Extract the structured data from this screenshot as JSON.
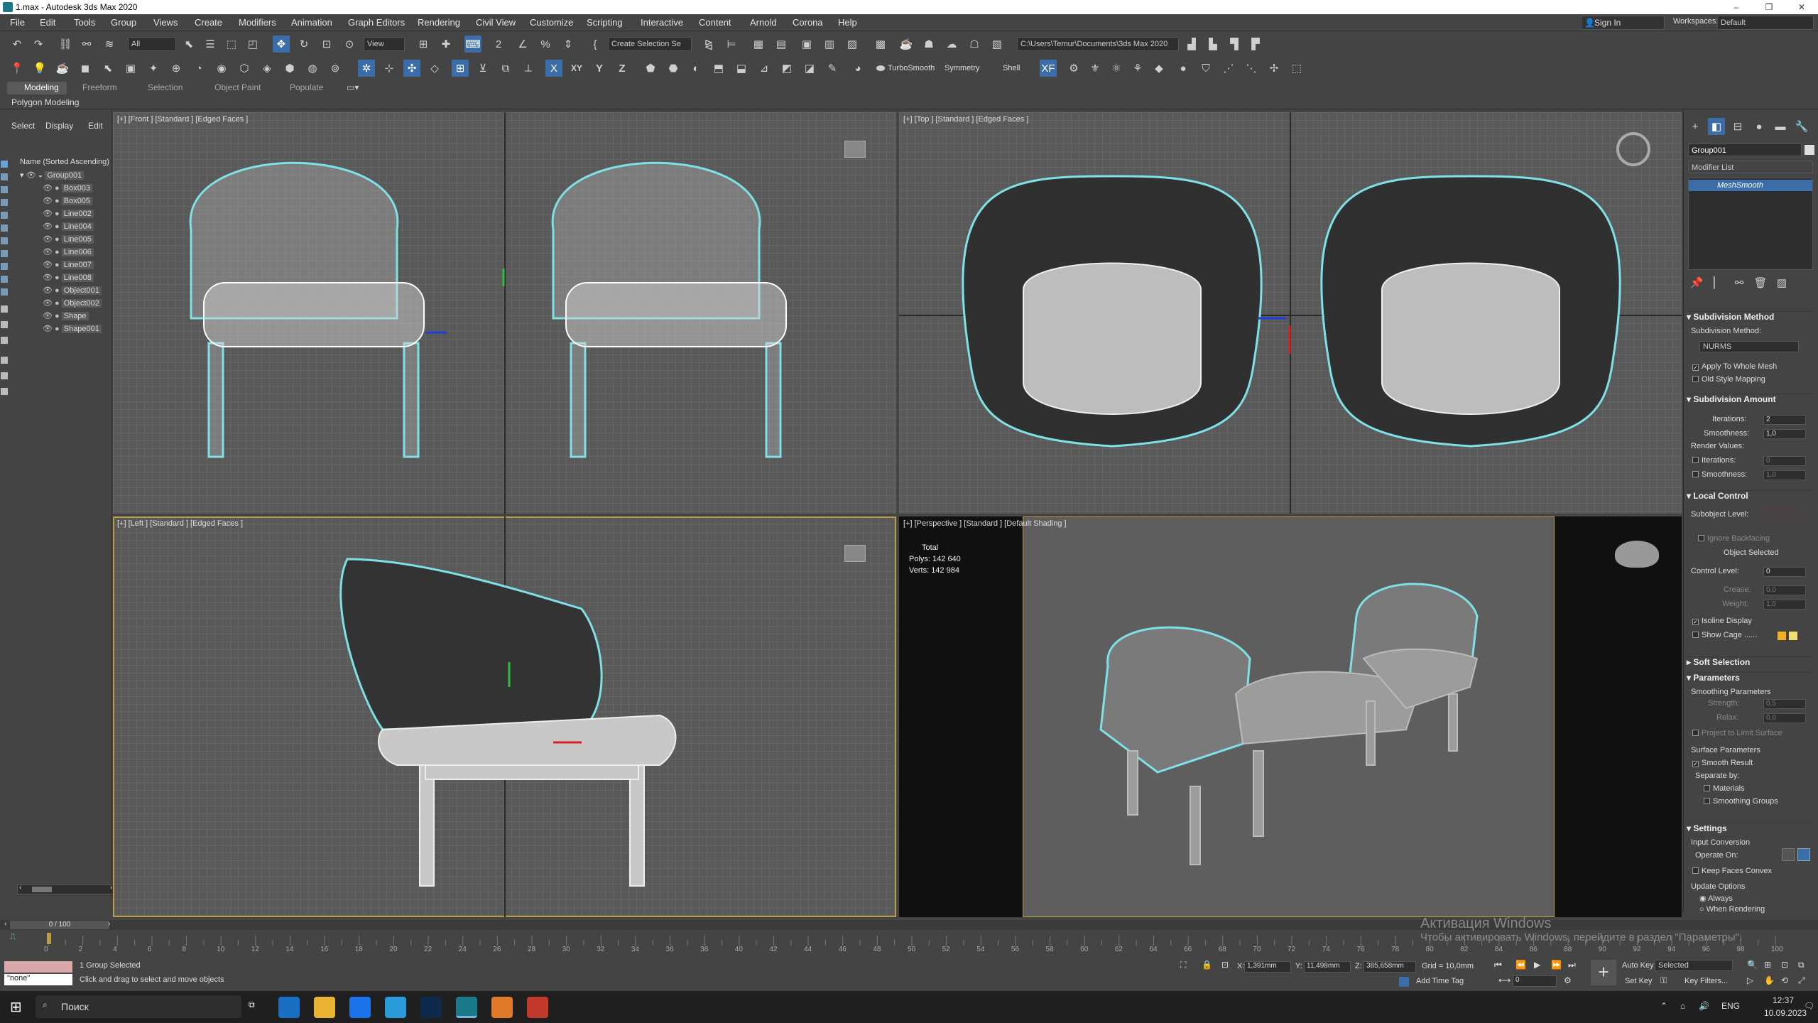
{
  "window": {
    "title": "1.max - Autodesk 3ds Max 2020",
    "minimize": "–",
    "maximize": "❐",
    "close": "✕"
  },
  "menu": [
    "File",
    "Edit",
    "Tools",
    "Group",
    "Views",
    "Create",
    "Modifiers",
    "Animation",
    "Graph Editors",
    "Rendering",
    "Civil View",
    "Customize",
    "Scripting",
    "Interactive",
    "Content",
    "Arnold",
    "Corona",
    "Help"
  ],
  "account": {
    "sign_in": "Sign In",
    "workspaces_label": "Workspaces:",
    "workspace": "Default"
  },
  "toolbar": {
    "filter": "All",
    "view": "View",
    "selection_set": "Create Selection Se",
    "path": "C:\\Users\\Temur\\Documents\\3ds Max 2020"
  },
  "toolbar2": {
    "turbosmooth": "TurboSmooth",
    "symmetry": "Symmetry",
    "shell": "Shell",
    "x": "X",
    "y": "Y",
    "z": "Z",
    "xy": "XY"
  },
  "ribbon": {
    "tabs": [
      "Modeling",
      "Freeform",
      "Selection",
      "Object Paint",
      "Populate"
    ],
    "panel": "Polygon Modeling"
  },
  "scene_explorer": {
    "tabs": [
      "Select",
      "Display",
      "Edit"
    ],
    "sort": "Name (Sorted Ascending)",
    "items": [
      "Group001",
      "Box003",
      "Box005",
      "Line002",
      "Line004",
      "Line005",
      "Line006",
      "Line007",
      "Line008",
      "Object001",
      "Object002",
      "Shape",
      "Shape001"
    ]
  },
  "viewports": {
    "front": "[+] [Front ] [Standard ] [Edged Faces ]",
    "top": "[+] [Top ] [Standard ] [Edged Faces ]",
    "left": "[+] [Left ] [Standard ] [Edged Faces ]",
    "persp": "[+] [Perspective ] [Standard ] [Default Shading ]"
  },
  "stats": {
    "total": "Total",
    "polys_label": "Polys:",
    "polys": "142 640",
    "verts_label": "Verts:",
    "verts": "142 984"
  },
  "command_panel": {
    "object_name": "Group001",
    "modifier_list": "Modifier List",
    "modifier": "MeshSmooth",
    "subdivision_method": {
      "title": "Subdivision Method",
      "label": "Subdivision Method:",
      "value": "NURMS",
      "apply_whole": "Apply To Whole Mesh",
      "old_style": "Old Style Mapping"
    },
    "subdivision_amount": {
      "title": "Subdivision Amount",
      "iterations_label": "Iterations:",
      "iterations": "2",
      "smoothness_label": "Smoothness:",
      "smoothness": "1,0",
      "render_values": "Render Values:",
      "r_iterations": "0",
      "r_smoothness": "1,0"
    },
    "local_control": {
      "title": "Local Control",
      "subobject_level": "Subobject Level:",
      "ignore_backfacing": "Ignore Backfacing",
      "object_selected": "Object Selected",
      "control_level_label": "Control Level:",
      "control_level": "0",
      "crease_label": "Crease:",
      "crease": "0,0",
      "weight_label": "Weight:",
      "weight": "1,0",
      "isoline": "Isoline Display",
      "show_cage": "Show Cage ......"
    },
    "soft_selection": {
      "title": "Soft Selection"
    },
    "parameters": {
      "title": "Parameters",
      "smoothing": "Smoothing Parameters",
      "strength_label": "Strength:",
      "strength": "0,5",
      "relax_label": "Relax:",
      "relax": "0,0",
      "project": "Project to Limit Surface",
      "surface": "Surface Parameters",
      "smooth_result": "Smooth Result",
      "separate_by": "Separate by:",
      "materials": "Materials",
      "smoothing_groups": "Smoothing Groups"
    },
    "settings": {
      "title": "Settings",
      "input_conversion": "Input Conversion",
      "operate_on": "Operate On:",
      "keep_convex": "Keep Faces Convex",
      "update_options": "Update Options",
      "always": "Always",
      "when_rendering": "When Rendering"
    }
  },
  "timeline": {
    "frame": "0 / 100",
    "ticks": [
      "0",
      "2",
      "4",
      "6",
      "8",
      "10",
      "12",
      "14",
      "16",
      "18",
      "20",
      "22",
      "24",
      "26",
      "28",
      "30",
      "32",
      "34",
      "36",
      "38",
      "40",
      "42",
      "44",
      "46",
      "48",
      "50",
      "52",
      "54",
      "56",
      "58",
      "60",
      "62",
      "64",
      "66",
      "68",
      "70",
      "72",
      "74",
      "76",
      "78",
      "80",
      "82",
      "84",
      "86",
      "88",
      "90",
      "92",
      "94",
      "96",
      "98",
      "100"
    ]
  },
  "status": {
    "maxscript": "\"none\"",
    "selected": "1 Group Selected",
    "prompt": "Click and drag to select and move objects",
    "x_label": "X:",
    "x": "1,391mm",
    "y_label": "Y:",
    "y": "11,498mm",
    "z_label": "Z:",
    "z": "385,658mm",
    "grid": "Grid = 10,0mm",
    "add_time_tag": "Add Time Tag",
    "auto_key": "Auto Key",
    "set_key": "Set Key",
    "selected_opt": "Selected",
    "key_filters": "Key Filters...",
    "frame": "0"
  },
  "watermark": {
    "line1": "Активация Windows",
    "line2": "Чтобы активировать Windows, перейдите в раздел \"Параметры\"."
  },
  "taskbar": {
    "search": "Поиск",
    "lang": "ENG",
    "time": "12:37",
    "date": "10.09.2023"
  },
  "colors": {
    "selection": "#7fe0e6",
    "accent": "#3b6ea8",
    "active_border": "#b99d46"
  }
}
